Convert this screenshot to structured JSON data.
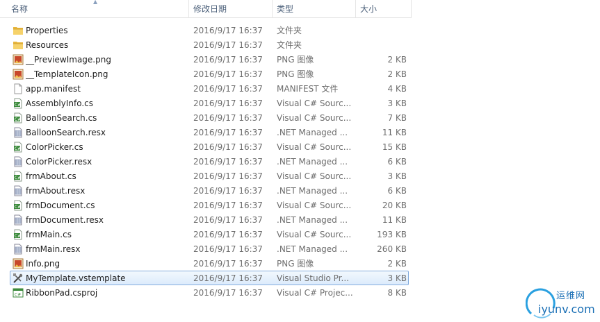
{
  "columns": {
    "name": "名称",
    "date": "修改日期",
    "type": "类型",
    "size": "大小"
  },
  "files": [
    {
      "name": "Properties",
      "date": "2016/9/17 16:37",
      "type": "文件夹",
      "size": "",
      "icon": "folder-icon"
    },
    {
      "name": "Resources",
      "date": "2016/9/17 16:37",
      "type": "文件夹",
      "size": "",
      "icon": "folder-icon"
    },
    {
      "name": "__PreviewImage.png",
      "date": "2016/9/17 16:37",
      "type": "PNG 图像",
      "size": "2 KB",
      "icon": "image-file-icon"
    },
    {
      "name": "__TemplateIcon.png",
      "date": "2016/9/17 16:37",
      "type": "PNG 图像",
      "size": "2 KB",
      "icon": "image-file-icon"
    },
    {
      "name": "app.manifest",
      "date": "2016/9/17 16:37",
      "type": "MANIFEST 文件",
      "size": "4 KB",
      "icon": "blank-file-icon"
    },
    {
      "name": "AssemblyInfo.cs",
      "date": "2016/9/17 16:37",
      "type": "Visual C# Sourc...",
      "size": "3 KB",
      "icon": "csharp-file-icon"
    },
    {
      "name": "BalloonSearch.cs",
      "date": "2016/9/17 16:37",
      "type": "Visual C# Sourc...",
      "size": "7 KB",
      "icon": "csharp-file-icon"
    },
    {
      "name": "BalloonSearch.resx",
      "date": "2016/9/17 16:37",
      "type": ".NET Managed ...",
      "size": "11 KB",
      "icon": "resx-file-icon"
    },
    {
      "name": "ColorPicker.cs",
      "date": "2016/9/17 16:37",
      "type": "Visual C# Sourc...",
      "size": "15 KB",
      "icon": "csharp-file-icon"
    },
    {
      "name": "ColorPicker.resx",
      "date": "2016/9/17 16:37",
      "type": ".NET Managed ...",
      "size": "6 KB",
      "icon": "resx-file-icon"
    },
    {
      "name": "frmAbout.cs",
      "date": "2016/9/17 16:37",
      "type": "Visual C# Sourc...",
      "size": "3 KB",
      "icon": "csharp-file-icon"
    },
    {
      "name": "frmAbout.resx",
      "date": "2016/9/17 16:37",
      "type": ".NET Managed ...",
      "size": "6 KB",
      "icon": "resx-file-icon"
    },
    {
      "name": "frmDocument.cs",
      "date": "2016/9/17 16:37",
      "type": "Visual C# Sourc...",
      "size": "20 KB",
      "icon": "csharp-file-icon"
    },
    {
      "name": "frmDocument.resx",
      "date": "2016/9/17 16:37",
      "type": ".NET Managed ...",
      "size": "11 KB",
      "icon": "resx-file-icon"
    },
    {
      "name": "frmMain.cs",
      "date": "2016/9/17 16:37",
      "type": "Visual C# Sourc...",
      "size": "193 KB",
      "icon": "csharp-file-icon"
    },
    {
      "name": "frmMain.resx",
      "date": "2016/9/17 16:37",
      "type": ".NET Managed ...",
      "size": "260 KB",
      "icon": "resx-file-icon"
    },
    {
      "name": "Info.png",
      "date": "2016/9/17 16:37",
      "type": "PNG 图像",
      "size": "2 KB",
      "icon": "image-file-icon"
    },
    {
      "name": "MyTemplate.vstemplate",
      "date": "2016/9/17 16:37",
      "type": "Visual Studio Pr...",
      "size": "3 KB",
      "icon": "vstemplate-file-icon",
      "selected": true
    },
    {
      "name": "RibbonPad.csproj",
      "date": "2016/9/17 16:37",
      "type": "Visual C# Projec...",
      "size": "8 KB",
      "icon": "csproj-file-icon"
    }
  ],
  "watermark": {
    "cn": "运维网",
    "en": "iyunv.com"
  },
  "colors": {
    "selection_border": "#84acdd",
    "selection_fill": "#dcebfc",
    "header_text": "#4c607a",
    "meta_text": "#6d6d6d",
    "watermark": "#1a6fb5"
  }
}
